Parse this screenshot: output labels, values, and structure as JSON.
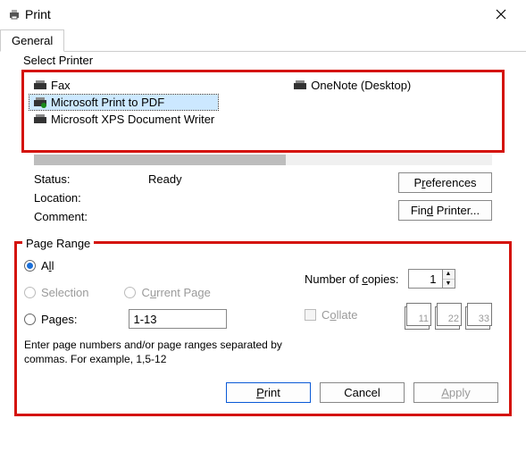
{
  "window": {
    "title": "Print"
  },
  "tabs": {
    "general": "General"
  },
  "printer_group": {
    "legend": "Select Printer",
    "items": {
      "fax": "Fax",
      "ms_pdf": "Microsoft Print to PDF",
      "ms_xps": "Microsoft XPS Document Writer",
      "onenote": "OneNote (Desktop)"
    },
    "selected": "ms_pdf"
  },
  "status": {
    "status_label": "Status:",
    "status_value": "Ready",
    "location_label": "Location:",
    "location_value": "",
    "comment_label": "Comment:",
    "comment_value": ""
  },
  "buttons": {
    "preferences": "Preferences",
    "find_printer": "Find Printer...",
    "print": "Print",
    "cancel": "Cancel",
    "apply": "Apply"
  },
  "accel": {
    "preferences": "r",
    "find_printer": "d",
    "all": "l",
    "current_page": "u",
    "pages": "g",
    "copies": "c",
    "collate": "o",
    "print": "P",
    "apply": "A"
  },
  "page_range": {
    "legend": "Page Range",
    "all": "All",
    "selection": "Selection",
    "current_page": "Current Page",
    "pages": "Pages:",
    "pages_value": "1-13",
    "hint": "Enter page numbers and/or page ranges separated by commas.  For example, 1,5-12"
  },
  "copies": {
    "label": "Number of copies:",
    "value": "1",
    "collate": "Collate",
    "stack1": "11",
    "stack2": "22",
    "stack3": "33"
  }
}
